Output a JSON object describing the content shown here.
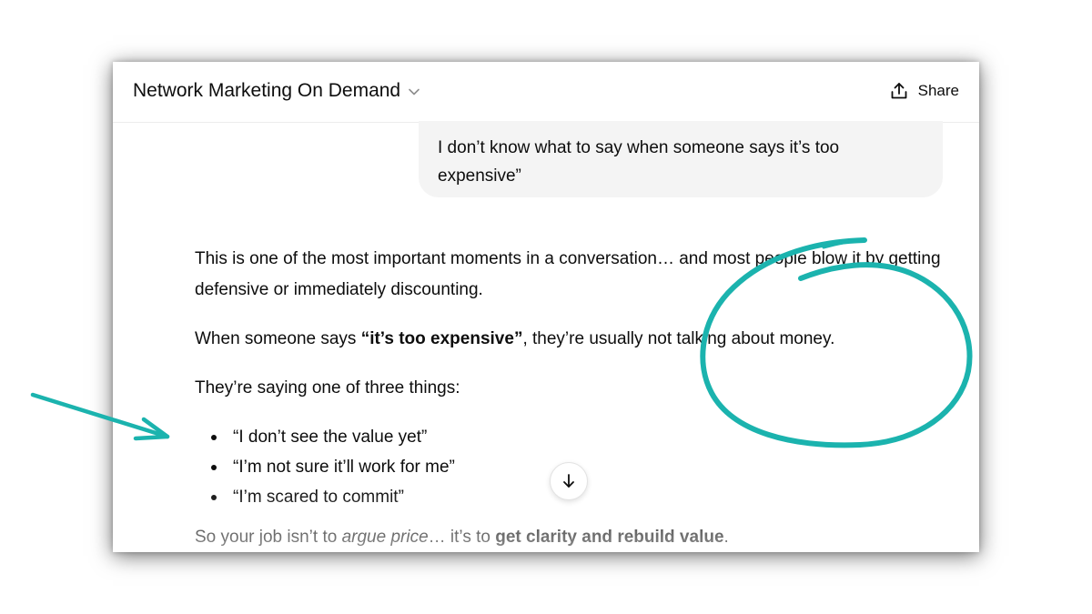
{
  "header": {
    "title": "Network Marketing On Demand",
    "chevron_icon": "chevron-down-icon",
    "share_label": "Share",
    "share_icon": "share-upload-icon"
  },
  "user_message": {
    "text": "I don’t know what to say when someone says it’s too expensive”"
  },
  "assistant_message": {
    "p1": "This is one of the most important moments in a conversation… and most people blow it by getting defensive or immediately discounting.",
    "p2_before": "When someone says ",
    "p2_bold": "“it’s too expensive”",
    "p2_after": ", they’re usually not talking about money.",
    "p3": "They’re saying one of three things:",
    "bullets": [
      "“I don’t see the value yet”",
      "“I’m not sure it’ll work for me”",
      "“I’m scared to commit”"
    ],
    "p5_a": "So your job isn’t to ",
    "p5_italic": "argue price",
    "p5_b": "… it’s to ",
    "p5_bold": "get clarity and rebuild value",
    "p5_c": "."
  },
  "scroll_button": {
    "icon": "arrow-down-icon"
  },
  "annotations": {
    "accent_color": "#1bb3ae",
    "arrow_icon": "pointer-arrow",
    "circle_icon": "highlight-circle"
  }
}
